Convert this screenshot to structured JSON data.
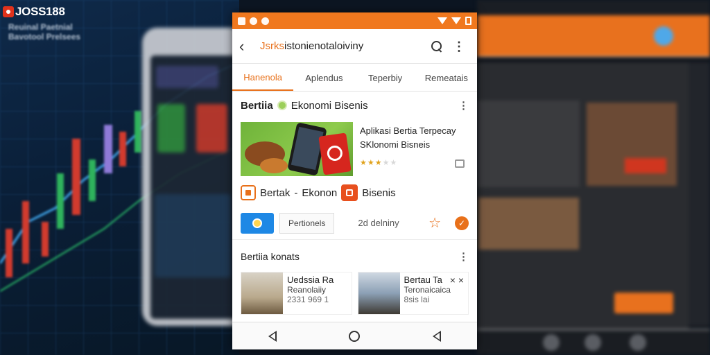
{
  "brand": {
    "logo_text": "JOSS188"
  },
  "background_left": {
    "caption_line1": "Reuinal Paetnial",
    "caption_line2": "Bavotool Prelsees"
  },
  "statusbar": {
    "color": "#f0781e"
  },
  "appbar": {
    "back_label": "‹",
    "title_accent": "Jsrks",
    "title_rest": "istonienotaloiviny",
    "menu_label": "⋮"
  },
  "tabs": [
    {
      "label": "Hanenola",
      "active": true
    },
    {
      "label": "Aplendus",
      "active": false
    },
    {
      "label": "Teperbiy",
      "active": false
    },
    {
      "label": "Remeatais",
      "active": false
    }
  ],
  "section1": {
    "title": "Bertiia",
    "subtitle": "Ekonomi Bisenis",
    "menu_label": "⋮"
  },
  "feature": {
    "title_line1": "Aplikasi Bertia Terpecay",
    "title_line2": "SKlonomi Bisneis",
    "rating": 3,
    "rating_max": 5
  },
  "category_row": {
    "part1": "Bertak",
    "sep": "-",
    "part2": "Ekonon",
    "part3": "Bisenis"
  },
  "actions": {
    "chip_label": "Pertionels",
    "meta": "2d delniny",
    "star_label": "☆",
    "check_label": "✓"
  },
  "section2": {
    "title": "Bertiia konats",
    "menu_label": "⋮"
  },
  "cards": [
    {
      "title": "Uedssia  Ra",
      "subtitle": "Reanolaiiy",
      "meta": "2331 969  1",
      "close_label": ""
    },
    {
      "title": "Bertau  Ta",
      "subtitle": "Teronaicaica",
      "meta": "8sis lai",
      "close_label": "× ×"
    }
  ],
  "colors": {
    "accent": "#e8701a",
    "blue": "#1e88e5"
  }
}
